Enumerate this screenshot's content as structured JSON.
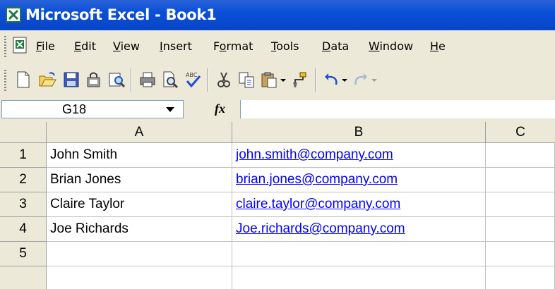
{
  "window": {
    "title": "Microsoft Excel - Book1"
  },
  "menu": [
    {
      "pre": "",
      "key": "F",
      "post": "ile"
    },
    {
      "pre": "",
      "key": "E",
      "post": "dit"
    },
    {
      "pre": "",
      "key": "V",
      "post": "iew"
    },
    {
      "pre": "",
      "key": "I",
      "post": "nsert"
    },
    {
      "pre": "F",
      "key": "o",
      "post": "rmat"
    },
    {
      "pre": "",
      "key": "T",
      "post": "ools"
    },
    {
      "pre": "",
      "key": "D",
      "post": "ata"
    },
    {
      "pre": "",
      "key": "W",
      "post": "indow"
    },
    {
      "pre": "",
      "key": "H",
      "post": "e"
    }
  ],
  "toolbar": [
    "new-icon",
    "open-icon",
    "save-icon",
    "permission-icon",
    "research-icon",
    "print-icon",
    "print-preview-icon",
    "spelling-icon",
    "cut-icon",
    "copy-icon",
    "paste-icon",
    "format-painter-icon",
    "undo-icon",
    "redo-icon"
  ],
  "formula_bar": {
    "name_box": "G18",
    "fx": "fx",
    "formula": ""
  },
  "sheet": {
    "columns": [
      "A",
      "B",
      "C"
    ],
    "rows": [
      {
        "num": "1",
        "a": "John Smith",
        "b": "john.smith@company.com"
      },
      {
        "num": "2",
        "a": "Brian Jones",
        "b": "brian.jones@company.com"
      },
      {
        "num": "3",
        "a": "Claire Taylor",
        "b": "claire.taylor@company.com"
      },
      {
        "num": "4",
        "a": "Joe Richards",
        "b": "Joe.richards@company.com"
      },
      {
        "num": "5",
        "a": "",
        "b": ""
      }
    ]
  },
  "colors": {
    "title_bar": "#0a4fd6",
    "chrome": "#ece9d8",
    "link": "#0000ff",
    "excel_green": "#1d7a3a"
  }
}
